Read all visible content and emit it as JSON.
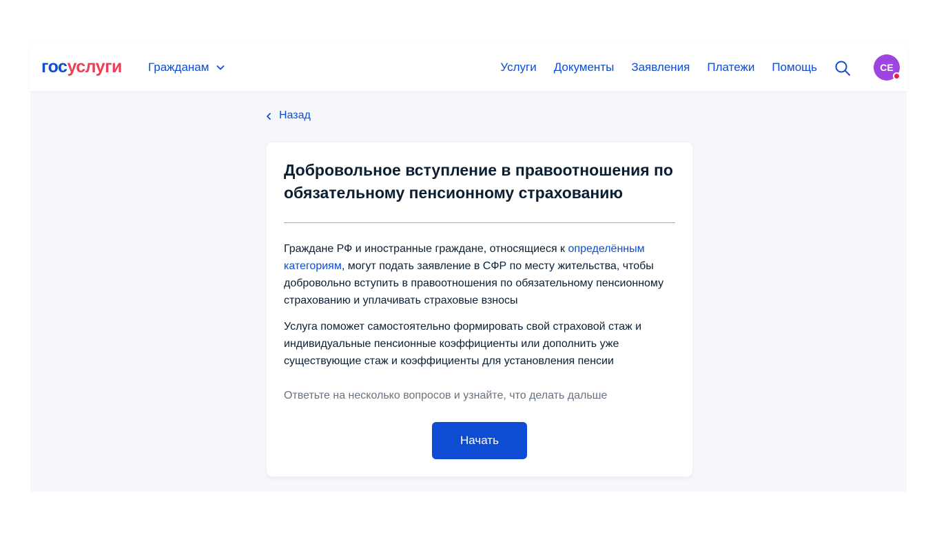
{
  "header": {
    "logo": {
      "part1": "гос",
      "part2": "услуги"
    },
    "citizens_menu": {
      "label": "Гражданам",
      "icon": "chevron-down-icon"
    },
    "nav": [
      {
        "label": "Услуги"
      },
      {
        "label": "Документы"
      },
      {
        "label": "Заявления"
      },
      {
        "label": "Платежи"
      },
      {
        "label": "Помощь"
      }
    ],
    "search_icon": "search-icon",
    "avatar": {
      "initials": "CE",
      "color": "#9e44e0",
      "badge_color": "#ee1d3c"
    }
  },
  "back": {
    "label": "Назад",
    "icon": "chevron-left-icon"
  },
  "card": {
    "title": "Добровольное вступление в правоотношения по обязательному пенсионному страхованию",
    "paragraph1": {
      "before": "Граждане РФ и иностранные граждане, относящиеся к ",
      "link": "определённым категориям",
      "after": ", могут подать заявление в СФР по месту жительства, чтобы добровольно вступить в правоотношения по обязательному пенсионному страхованию и уплачивать страховые взносы"
    },
    "paragraph2": "Услуга поможет самостоятельно формировать свой страховой стаж и индивидуальные пенсионные коэффициенты или дополнить уже существующие стаж и коэффициенты для установления пенсии",
    "hint": "Ответьте на несколько вопросов и узнайте, что делать дальше",
    "start_button": "Начать"
  },
  "colors": {
    "accent": "#0d4cd3",
    "brand_red": "#ee3f58",
    "page_bg": "#f5f7fa",
    "text": "#0b1f33",
    "muted_text": "#66727f"
  }
}
